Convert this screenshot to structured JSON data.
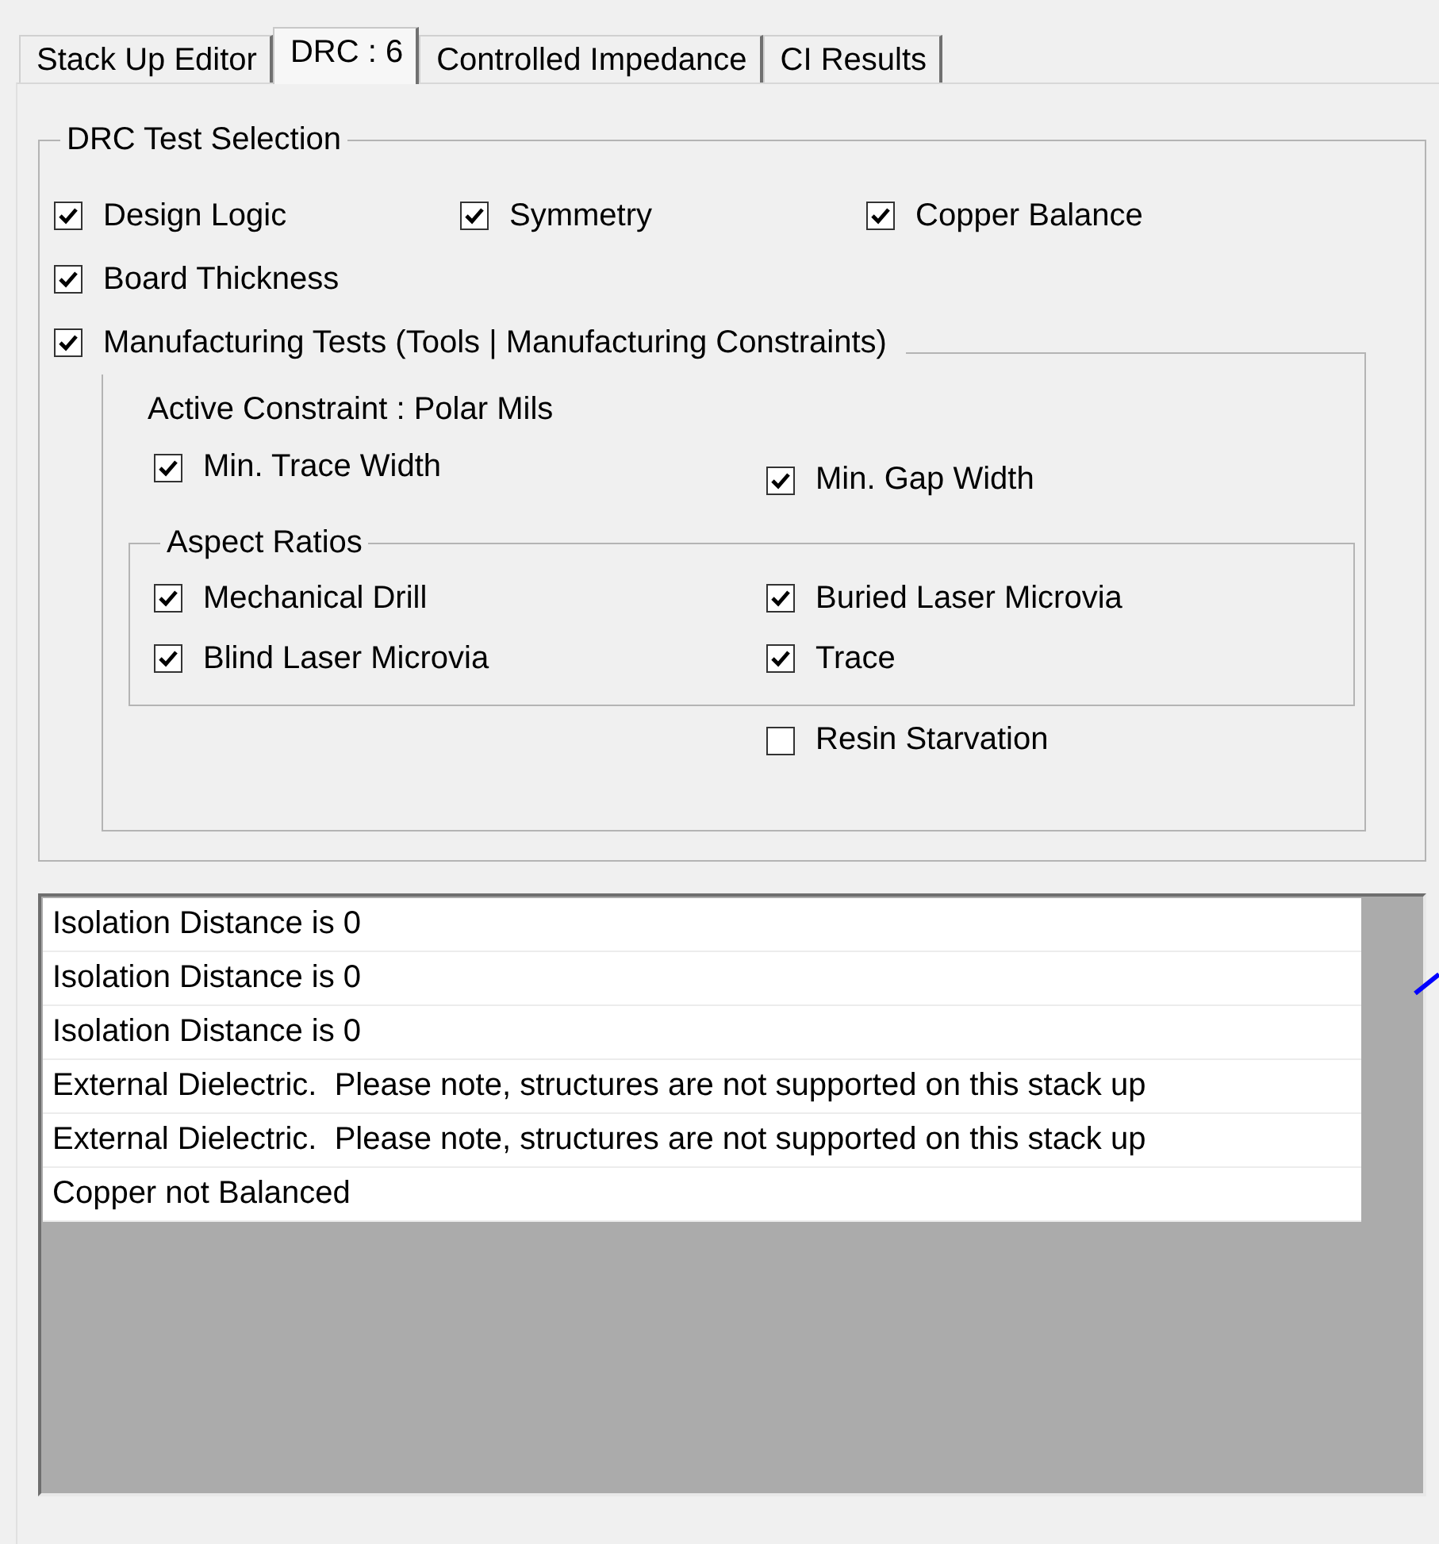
{
  "tabs": [
    {
      "label": "Stack Up Editor",
      "selected": false
    },
    {
      "label": "DRC : 6",
      "selected": true
    },
    {
      "label": "Controlled Impedance",
      "selected": false
    },
    {
      "label": "CI Results",
      "selected": false
    }
  ],
  "test_selection": {
    "title": "DRC Test Selection",
    "tests": [
      {
        "label": "Design Logic",
        "checked": true
      },
      {
        "label": "Symmetry",
        "checked": true
      },
      {
        "label": "Copper Balance",
        "checked": true
      },
      {
        "label": "Board Thickness",
        "checked": true
      }
    ],
    "manufacturing": {
      "label": "Manufacturing Tests (Tools | Manufacturing Constraints)",
      "checked": true,
      "active_constraint": "Active Constraint : Polar Mils",
      "checks": [
        {
          "label": "Min. Trace Width",
          "checked": true
        },
        {
          "label": "Min. Gap Width",
          "checked": true
        }
      ],
      "aspect_ratios": {
        "title": "Aspect Ratios",
        "checks": [
          {
            "label": "Mechanical Drill",
            "checked": true
          },
          {
            "label": "Buried Laser Microvia",
            "checked": true
          },
          {
            "label": "Blind Laser Microvia",
            "checked": true
          },
          {
            "label": "Trace",
            "checked": true
          }
        ]
      },
      "resin_starvation": {
        "label": "Resin Starvation",
        "checked": false
      }
    }
  },
  "messages": [
    "Isolation Distance is 0",
    "Isolation Distance is 0",
    "Isolation Distance is 0",
    "External Dielectric.  Please note, structures are not supported on this stack up",
    "External Dielectric.  Please note, structures are not supported on this stack up",
    "Copper not Balanced"
  ]
}
